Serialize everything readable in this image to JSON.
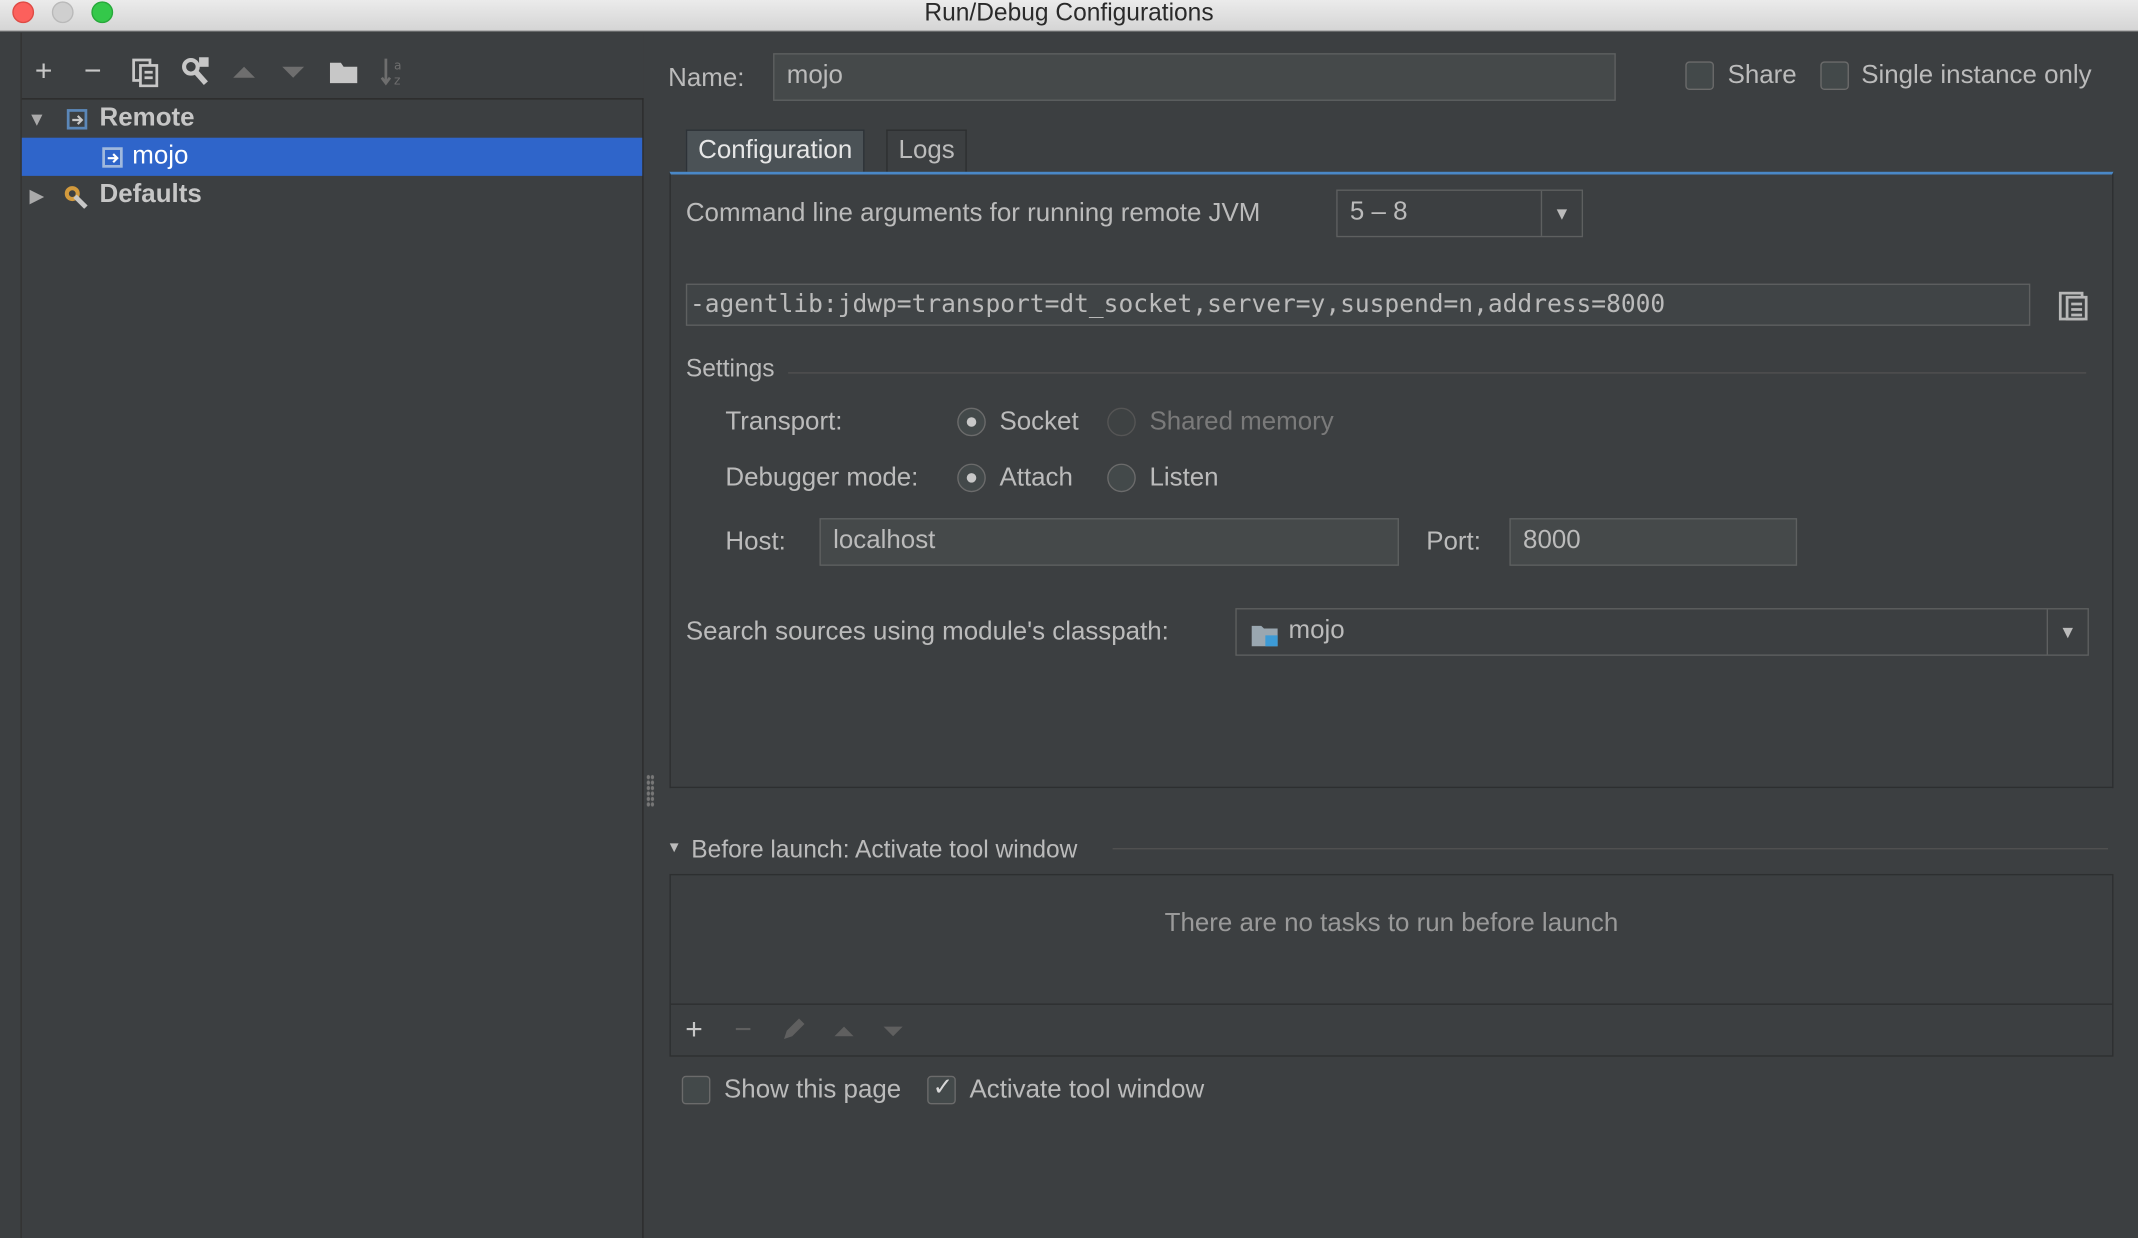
{
  "window": {
    "title": "Run/Debug Configurations"
  },
  "toolbar": {
    "icons": [
      "add-icon",
      "remove-icon",
      "copy-icon",
      "edit-defaults-icon",
      "move-up-icon",
      "move-down-icon",
      "folder-icon",
      "sort-icon"
    ]
  },
  "tree": {
    "remote_label": "Remote",
    "mojo_label": "mojo",
    "defaults_label": "Defaults"
  },
  "name_row": {
    "label": "Name:",
    "value": "mojo",
    "share_label": "Share",
    "share_checked": false,
    "single_label": "Single instance only",
    "single_checked": false
  },
  "tabs": [
    {
      "label": "Configuration",
      "active": true
    },
    {
      "label": "Logs",
      "active": false
    }
  ],
  "config": {
    "jvm_args_label": "Command line arguments for running remote JVM",
    "jvm_version": "5 – 8",
    "jvm_args_value": "-agentlib:jdwp=transport=dt_socket,server=y,suspend=n,address=8000",
    "settings_label": "Settings",
    "transport_label": "Transport:",
    "transport_socket": "Socket",
    "transport_shared": "Shared memory",
    "debugger_mode_label": "Debugger mode:",
    "mode_attach": "Attach",
    "mode_listen": "Listen",
    "host_label": "Host:",
    "host_value": "localhost",
    "port_label": "Port:",
    "port_value": "8000",
    "search_sources_label": "Search sources using module's classpath:",
    "module_value": "mojo"
  },
  "before_launch": {
    "title": "Before launch: Activate tool window",
    "empty_text": "There are no tasks to run before launch",
    "show_page_label": "Show this page",
    "show_page_checked": false,
    "activate_label": "Activate tool window",
    "activate_checked": true
  },
  "colors": {
    "selection": "#2f65ca",
    "tab_underline": "#4a88c7",
    "background": "#3c3f41"
  }
}
